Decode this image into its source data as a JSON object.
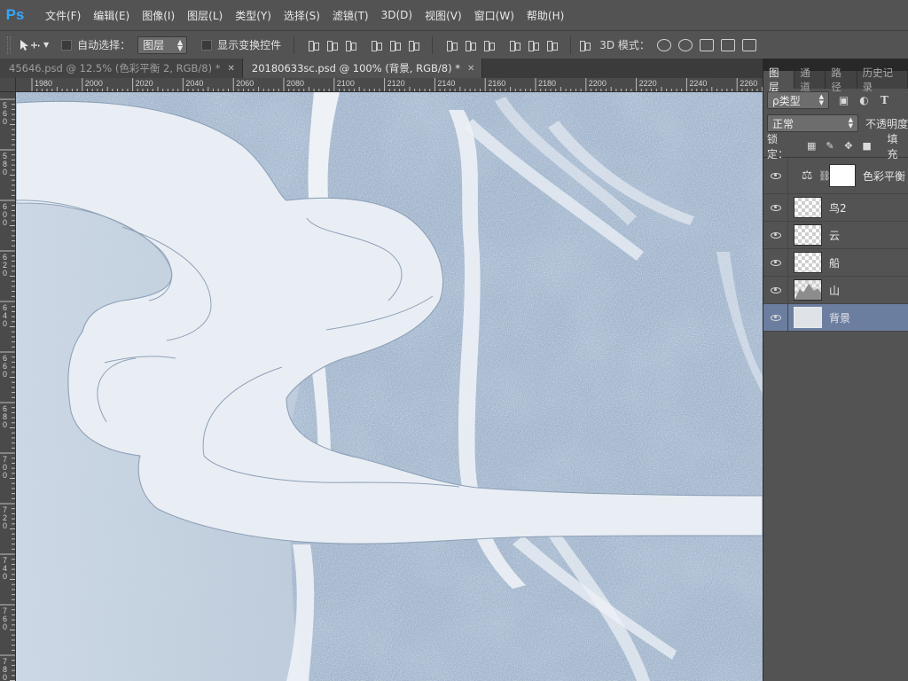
{
  "app": {
    "logo": "Ps"
  },
  "menu": [
    "文件(F)",
    "编辑(E)",
    "图像(I)",
    "图层(L)",
    "类型(Y)",
    "选择(S)",
    "滤镜(T)",
    "3D(D)",
    "视图(V)",
    "窗口(W)",
    "帮助(H)"
  ],
  "options": {
    "auto_select_label": "自动选择：",
    "auto_select_value": "图层",
    "show_transform_label": "显示变换控件",
    "mode_3d_label": "3D 模式："
  },
  "tabs": [
    {
      "label": "45646.psd @ 12.5% (色彩平衡 2, RGB/8) *",
      "active": false
    },
    {
      "label": "20180633sc.psd @ 100% (背景, RGB/8) *",
      "active": true
    }
  ],
  "ruler_top": [
    "1980",
    "2000",
    "2020",
    "2040",
    "2060",
    "2080",
    "2100",
    "2120",
    "2140",
    "2160",
    "2180",
    "2200",
    "2220",
    "2240",
    "2260"
  ],
  "ruler_left": [
    "560",
    "580",
    "600",
    "620",
    "640",
    "660",
    "680",
    "700",
    "720",
    "740",
    "760",
    "780"
  ],
  "panel": {
    "tabs": [
      "图层",
      "通道",
      "路径",
      "历史记录"
    ],
    "filter_label": "ρ类型",
    "blend_mode": "正常",
    "opacity_label": "不透明度",
    "lock_label": "锁定：",
    "fill_label": "填充",
    "layers": [
      {
        "name": "色彩平衡",
        "type": "adjustment",
        "selected": false
      },
      {
        "name": "鸟2",
        "type": "pixel",
        "selected": false
      },
      {
        "name": "云",
        "type": "pixel",
        "selected": false
      },
      {
        "name": "船",
        "type": "pixel",
        "selected": false
      },
      {
        "name": "山",
        "type": "pixel",
        "selected": false
      },
      {
        "name": "背景",
        "type": "background",
        "selected": true
      }
    ]
  },
  "colors": {
    "accent": "#31a8ff",
    "panel_bg": "#535353",
    "selected_layer": "#6c7ea0",
    "canvas_blue": "#9fb3cb",
    "cloud_fill": "#e9eef4"
  }
}
